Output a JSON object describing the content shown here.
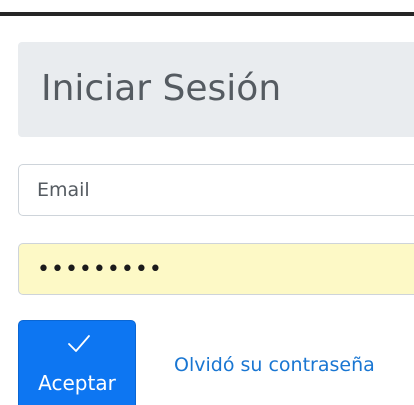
{
  "login": {
    "title": "Iniciar Sesión",
    "email_placeholder": "Email",
    "password_value": "•••••••••",
    "submit_label": "Aceptar",
    "forgot_label": "Olvidó su contraseña"
  },
  "icons": {
    "submit": "check-icon"
  },
  "colors": {
    "primary": "#0d76f2",
    "link": "#1976d2",
    "autofill": "#fdf9c6",
    "panel": "#e9ecef"
  }
}
